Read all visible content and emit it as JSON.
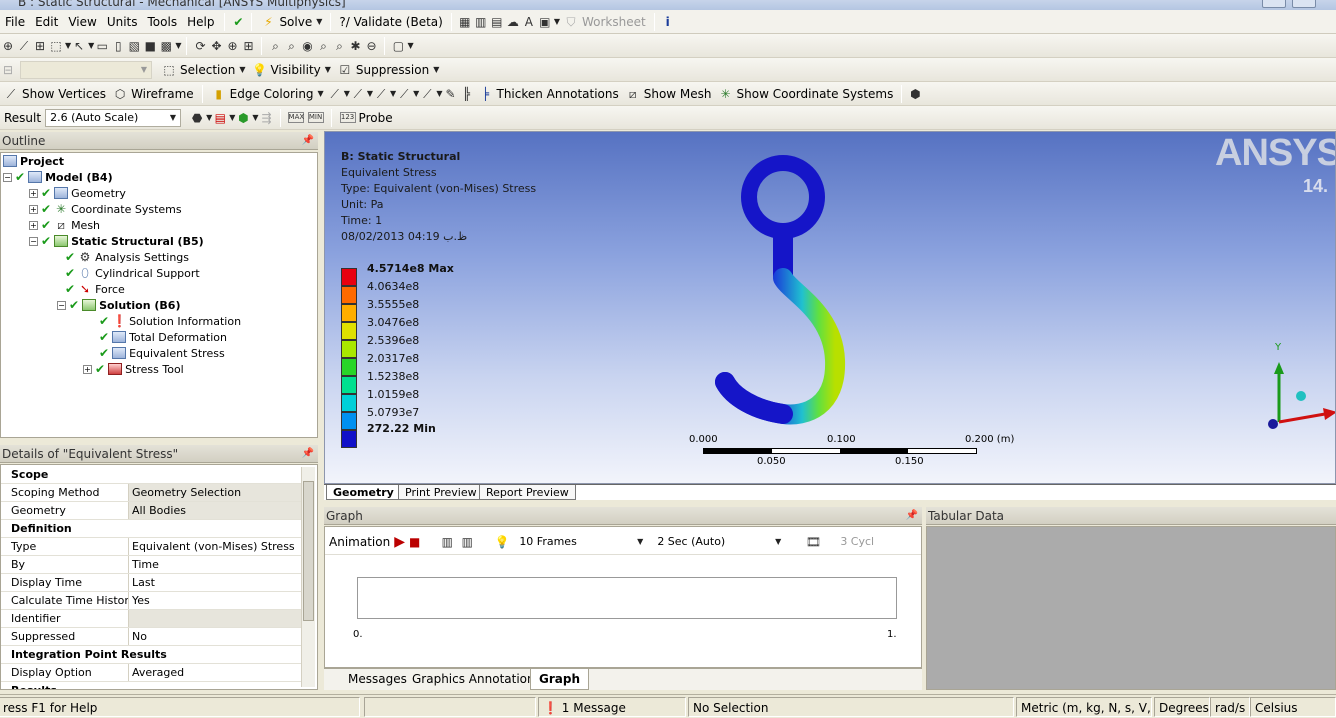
{
  "window": {
    "title": "B : Static Structural - Mechanical [ANSYS Multiphysics]"
  },
  "menu": {
    "items": [
      "File",
      "Edit",
      "View",
      "Units",
      "Tools",
      "Help"
    ],
    "solve": "Solve",
    "validate": "?/ Validate (Beta)",
    "worksheet": "Worksheet"
  },
  "toolbar3": {
    "selection": "Selection",
    "visibility": "Visibility",
    "suppression": "Suppression"
  },
  "toolbar4": {
    "show_vertices": "Show Vertices",
    "wireframe": "Wireframe",
    "edge_coloring": "Edge Coloring",
    "thicken": "Thicken Annotations",
    "show_mesh": "Show Mesh",
    "show_cs": "Show Coordinate Systems"
  },
  "toolbar5": {
    "result_label": "Result",
    "scale": "2.6 (Auto Scale)",
    "max_btn": "MAX",
    "min_btn": "MIN",
    "probe_icon_text": "123",
    "probe": "Probe"
  },
  "outline": {
    "header": "Outline",
    "tree": {
      "project": "Project",
      "model": "Model (B4)",
      "geometry": "Geometry",
      "coordinate_systems": "Coordinate Systems",
      "mesh": "Mesh",
      "static_structural": "Static Structural (B5)",
      "analysis_settings": "Analysis Settings",
      "cylindrical_support": "Cylindrical Support",
      "force": "Force",
      "solution": "Solution (B6)",
      "solution_information": "Solution Information",
      "total_deformation": "Total Deformation",
      "equivalent_stress": "Equivalent Stress",
      "stress_tool": "Stress Tool"
    }
  },
  "details": {
    "header": "Details of \"Equivalent Stress\"",
    "sections": {
      "scope": "Scope",
      "definition": "Definition",
      "integration": "Integration Point Results",
      "results": "Results"
    },
    "rows": {
      "scoping_method": {
        "k": "Scoping Method",
        "v": "Geometry Selection"
      },
      "geometry": {
        "k": "Geometry",
        "v": "All Bodies"
      },
      "type": {
        "k": "Type",
        "v": "Equivalent (von-Mises) Stress"
      },
      "by": {
        "k": "By",
        "v": "Time"
      },
      "display_time": {
        "k": "Display Time",
        "v": "Last"
      },
      "calc_time_history": {
        "k": "Calculate Time History",
        "v": "Yes"
      },
      "identifier": {
        "k": "Identifier",
        "v": ""
      },
      "suppressed": {
        "k": "Suppressed",
        "v": "No"
      },
      "display_option": {
        "k": "Display Option",
        "v": "Averaged"
      }
    }
  },
  "viewport": {
    "title": "B: Static Structural",
    "result_type": "Equivalent Stress",
    "type_line": "Type: Equivalent (von-Mises) Stress",
    "unit_line": "Unit: Pa",
    "time_line": "Time: 1",
    "date_line": "08/02/2013 04:19 ظ.ب",
    "logo": "ANSYS",
    "version": "14.",
    "legend": {
      "max": "4.5714e8 Max",
      "levels": [
        "4.0634e8",
        "3.5555e8",
        "3.0476e8",
        "2.5396e8",
        "2.0317e8",
        "1.5238e8",
        "1.0159e8",
        "5.0793e7"
      ],
      "min": "272.22 Min",
      "colors": [
        "#e8000f",
        "#ff6a00",
        "#ffae00",
        "#e0e000",
        "#a9e800",
        "#28d628",
        "#00e090",
        "#00d0d8",
        "#0090f0",
        "#1010c8"
      ]
    },
    "scale": {
      "t0": "0.000",
      "t1": "0.100",
      "t2": "0.200 (m)",
      "b1": "0.050",
      "b2": "0.150"
    },
    "triad": {
      "y": "Y"
    }
  },
  "view_tabs": [
    "Geometry",
    "Print Preview",
    "Report Preview"
  ],
  "graph": {
    "header": "Graph",
    "animation": "Animation",
    "frames": "10 Frames",
    "duration": "2 Sec (Auto)",
    "cycles": "3 Cycl",
    "axis_min": "0.",
    "axis_max": "1."
  },
  "tabular": {
    "header": "Tabular Data"
  },
  "bottom_tabs": [
    "Messages",
    "Graphics Annotations",
    "Graph"
  ],
  "status": {
    "help": "ress F1 for Help",
    "messages": "1 Message",
    "selection": "No Selection",
    "units": "Metric (m, kg, N, s, V, A)",
    "angle": "Degrees",
    "rate": "rad/s",
    "temp": "Celsius"
  }
}
